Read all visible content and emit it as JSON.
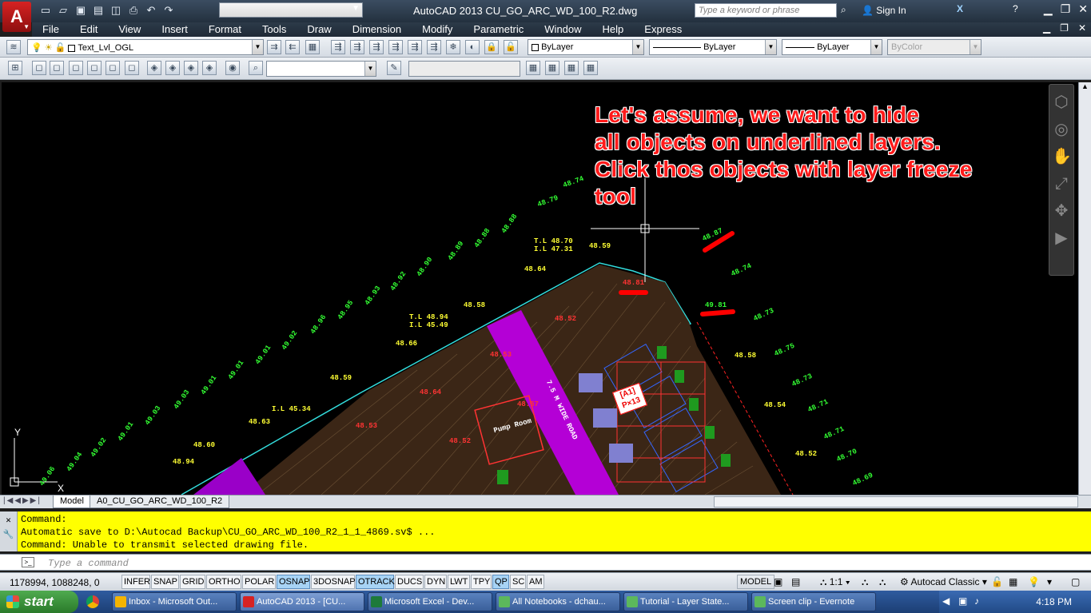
{
  "window": {
    "title": "AutoCAD 2013    CU_GO_ARC_WD_100_R2.dwg",
    "search_placeholder": "Type a keyword or phrase",
    "sign_in": "Sign In",
    "app_letter": "A"
  },
  "menu": [
    "File",
    "Edit",
    "View",
    "Insert",
    "Format",
    "Tools",
    "Draw",
    "Dimension",
    "Modify",
    "Parametric",
    "Window",
    "Help",
    "Express"
  ],
  "toolbar": {
    "layer_value": "Text_Lvl_OGL",
    "color_value": "ByLayer",
    "linetype_value": "ByLayer",
    "lineweight_value": "ByLayer",
    "plotstyle_value": "ByColor"
  },
  "annotation": {
    "text": "Let's assume, we want to hide\nall objects on underlined layers.\nClick thos objects with layer freeze\ntool"
  },
  "drawing": {
    "green_levels": [
      "48.74",
      "48.79",
      "48.88",
      "48.88",
      "48.89",
      "48.90",
      "48.92",
      "48.93",
      "48.95",
      "48.96",
      "49.02",
      "49.01",
      "49.01",
      "49.01",
      "49.03",
      "49.03",
      "49.01",
      "49.02",
      "49.04",
      "49.06",
      "48.87",
      "48.74",
      "48.73",
      "48.75",
      "48.73",
      "48.71",
      "48.71",
      "48.70",
      "48.69"
    ],
    "yellow_levels": [
      "48.59",
      "48.64",
      "48.58",
      "48.66",
      "48.59",
      "48.63",
      "48.60",
      "48.94",
      "48.58",
      "48.54",
      "48.52"
    ],
    "red_levels": [
      "48.81",
      "49.81",
      "48.52",
      "48.64",
      "48.53",
      "48.53",
      "48.52",
      "48.67"
    ],
    "tl_label_1": "T.L 48.70",
    "il_label_1": "I.L 47.31",
    "tl_label_2": "T.L 48.94",
    "il_label_2": "I.L 45.49",
    "il_label_3": "I.L 45.34",
    "unit_label_1": "[A1]",
    "unit_label_2": "P×13",
    "pump_room": "Pump Room",
    "road_label": "7.5 M WIDE ROAD"
  },
  "tabs": {
    "model": "Model",
    "layout": "A0_CU_GO_ARC_WD_100_R2"
  },
  "command": {
    "lines": [
      "Command:",
      "Automatic save to D:\\Autocad Backup\\CU_GO_ARC_WD_100_R2_1_1_4869.sv$ ...",
      "Command: Unable to transmit selected drawing file."
    ],
    "placeholder": "Type a command"
  },
  "status": {
    "coords": "1178994, 1088248, 0",
    "toggles": [
      {
        "label": "INFER",
        "on": false
      },
      {
        "label": "SNAP",
        "on": false
      },
      {
        "label": "GRID",
        "on": false
      },
      {
        "label": "ORTHO",
        "on": false
      },
      {
        "label": "POLAR",
        "on": false
      },
      {
        "label": "OSNAP",
        "on": true
      },
      {
        "label": "3DOSNAP",
        "on": false
      },
      {
        "label": "OTRACK",
        "on": true
      },
      {
        "label": "DUCS",
        "on": false
      },
      {
        "label": "DYN",
        "on": false
      },
      {
        "label": "LWT",
        "on": false
      },
      {
        "label": "TPY",
        "on": false
      },
      {
        "label": "QP",
        "on": true
      },
      {
        "label": "SC",
        "on": false
      },
      {
        "label": "AM",
        "on": false
      }
    ],
    "model": "MODEL",
    "scale": "1:1",
    "workspace": "Autocad Classic"
  },
  "taskbar": {
    "start": "start",
    "tasks": [
      {
        "label": "Inbox - Microsoft Out...",
        "color": "#f4b400"
      },
      {
        "label": "AutoCAD 2013 - [CU...",
        "color": "#d62222"
      },
      {
        "label": "Microsoft Excel - Dev...",
        "color": "#1d7a3a"
      },
      {
        "label": "All Notebooks - dchau...",
        "color": "#5cb85c"
      },
      {
        "label": "Tutorial - Layer State...",
        "color": "#5cb85c"
      },
      {
        "label": "Screen clip - Evernote",
        "color": "#5cb85c"
      }
    ],
    "clock": "4:18 PM"
  }
}
